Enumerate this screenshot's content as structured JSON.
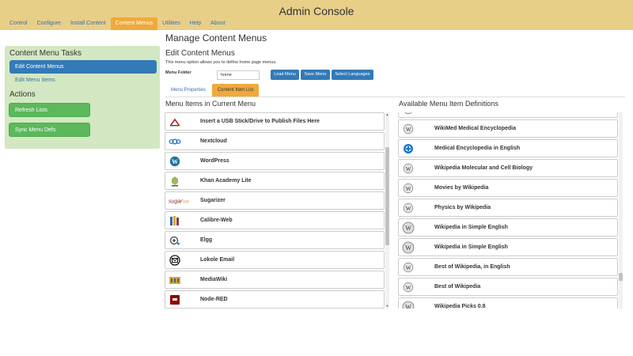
{
  "app": {
    "title": "Admin Console"
  },
  "nav": {
    "tabs": [
      {
        "label": "Control"
      },
      {
        "label": "Configure"
      },
      {
        "label": "Install Content"
      },
      {
        "label": "Content Menus"
      },
      {
        "label": "Utilities"
      },
      {
        "label": "Help"
      },
      {
        "label": "About"
      }
    ],
    "active_index": 3
  },
  "sidebar": {
    "tasks_heading": "Content Menu Tasks",
    "items": [
      {
        "label": "Edit Content Menus"
      },
      {
        "label": "Edit Menu Items"
      }
    ],
    "actions_heading": "Actions",
    "actions": [
      {
        "label": "Refresh Lists"
      },
      {
        "label": "Sync Menu Defs"
      }
    ]
  },
  "main": {
    "title": "Manage Content Menus",
    "subtitle": "Edit Content Menus",
    "description": "This menu option allows you to define home page menus.",
    "folder_label": "Menu Folder",
    "folder_value": "home",
    "buttons": {
      "load": "Load Menu",
      "save": "Save Menu",
      "languages": "Select Languages"
    },
    "subtabs": [
      {
        "label": "Menu Properties"
      },
      {
        "label": "Content Item List"
      }
    ],
    "active_subtab": 1
  },
  "current_menu": {
    "title": "Menu Items in Current Menu",
    "items": [
      {
        "label": "Insert a USB Stick/Drive to Publish Files Here",
        "icon": "usb-icon"
      },
      {
        "label": "Nextcloud",
        "icon": "nextcloud-icon"
      },
      {
        "label": "WordPress",
        "icon": "wordpress-icon"
      },
      {
        "label": "Khan Academy Lite",
        "icon": "khan-icon"
      },
      {
        "label": "Sugarizer",
        "icon": "sugarizer-icon"
      },
      {
        "label": "Calibre-Web",
        "icon": "calibre-icon"
      },
      {
        "label": "Elgg",
        "icon": "elgg-icon"
      },
      {
        "label": "Lokole Email",
        "icon": "email-icon"
      },
      {
        "label": "MediaWiki",
        "icon": "mediawiki-icon"
      },
      {
        "label": "Node-RED",
        "icon": "nodered-icon"
      }
    ]
  },
  "available_items": {
    "title": "Available Menu Item Definitions",
    "items": [
      {
        "label": "WikiMed Medical Encyclopedia",
        "icon": "wikipedia-icon"
      },
      {
        "label": "Medical Encyclopedia in English",
        "icon": "medical-icon"
      },
      {
        "label": "Wikipedia Molecular and Cell Biology",
        "icon": "wikipedia-icon"
      },
      {
        "label": "Movies by Wikipedia",
        "icon": "wikipedia-icon"
      },
      {
        "label": "Physics by Wikipedia",
        "icon": "wikipedia-icon"
      },
      {
        "label": "Wikipedia in Simple English",
        "icon": "wikipedia-icon"
      },
      {
        "label": "Wikipedia in Simple English",
        "icon": "wikipedia-icon"
      },
      {
        "label": "Best of Wikipedia, in English",
        "icon": "wikipedia-icon"
      },
      {
        "label": "Best of Wikipedia",
        "icon": "wikipedia-icon"
      },
      {
        "label": "Wikipedia Picks 0.8",
        "icon": "wikipedia-icon"
      }
    ]
  },
  "colors": {
    "header": "#e8cf88",
    "active_tab": "#f0a93a",
    "sidebar": "#d3e8c2",
    "primary": "#337ab7",
    "success": "#5cb85c"
  }
}
